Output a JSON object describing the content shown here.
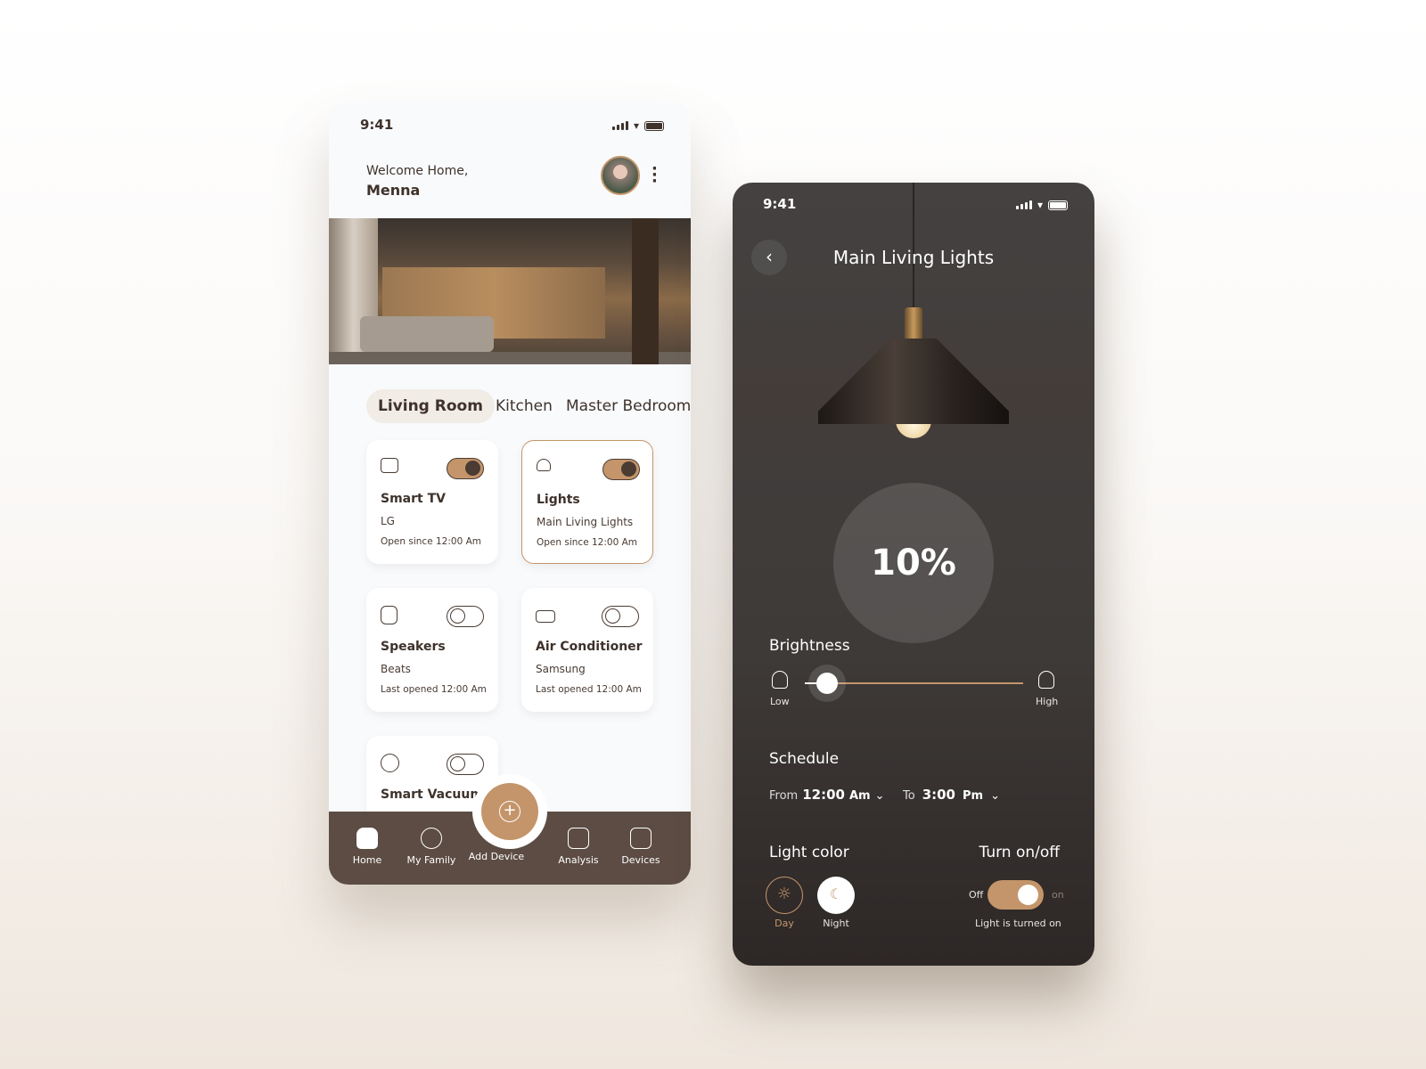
{
  "home": {
    "status_time": "9:41",
    "welcome": "Welcome Home,",
    "user_name": "Menna",
    "rooms": [
      {
        "label": "Living Room",
        "active": true
      },
      {
        "label": "Kitchen",
        "active": false
      },
      {
        "label": "Master Bedroom",
        "active": false
      }
    ],
    "devices": [
      {
        "name": "Smart TV",
        "brand": "LG",
        "status": "Open since 12:00 Am",
        "on": true,
        "icon": "tv-icon"
      },
      {
        "name": "Lights",
        "brand": "Main Living Lights",
        "status": "Open since 12:00 Am",
        "on": true,
        "icon": "lamp-icon",
        "selected": true
      },
      {
        "name": "Speakers",
        "brand": "Beats",
        "status": "Last opened 12:00 Am",
        "on": false,
        "icon": "speaker-icon"
      },
      {
        "name": "Air Conditioner",
        "brand": "Samsung",
        "status": "Last opened 12:00 Am",
        "on": false,
        "icon": "ac-icon"
      },
      {
        "name": "Smart Vacuum",
        "on": false,
        "icon": "vacuum-icon"
      }
    ],
    "nav": [
      {
        "label": "Home",
        "icon": "home-icon"
      },
      {
        "label": "My Family",
        "icon": "family-icon"
      },
      {
        "label": "Add Device",
        "icon": "plus-icon"
      },
      {
        "label": "Analysis",
        "icon": "analysis-icon"
      },
      {
        "label": "Devices",
        "icon": "devices-icon"
      }
    ]
  },
  "detail": {
    "status_time": "9:41",
    "title": "Main Living Lights",
    "brightness_value": "10%",
    "brightness_fraction": 0.1,
    "brightness_label": "Brightness",
    "low": "Low",
    "high": "High",
    "schedule_label": "Schedule",
    "from_label": "From",
    "from_time": "12:00",
    "from_period": "Am",
    "to_label": "To",
    "to_time": "3:00",
    "to_period": "Pm",
    "light_color_label": "Light color",
    "day": "Day",
    "night": "Night",
    "turn_label": "Turn on/off",
    "off": "Off",
    "on": "on",
    "power_status": "Light is turned on"
  },
  "colors": {
    "accent": "#c4956a",
    "dark_brown": "#5c4c43",
    "text": "#3e322b"
  }
}
